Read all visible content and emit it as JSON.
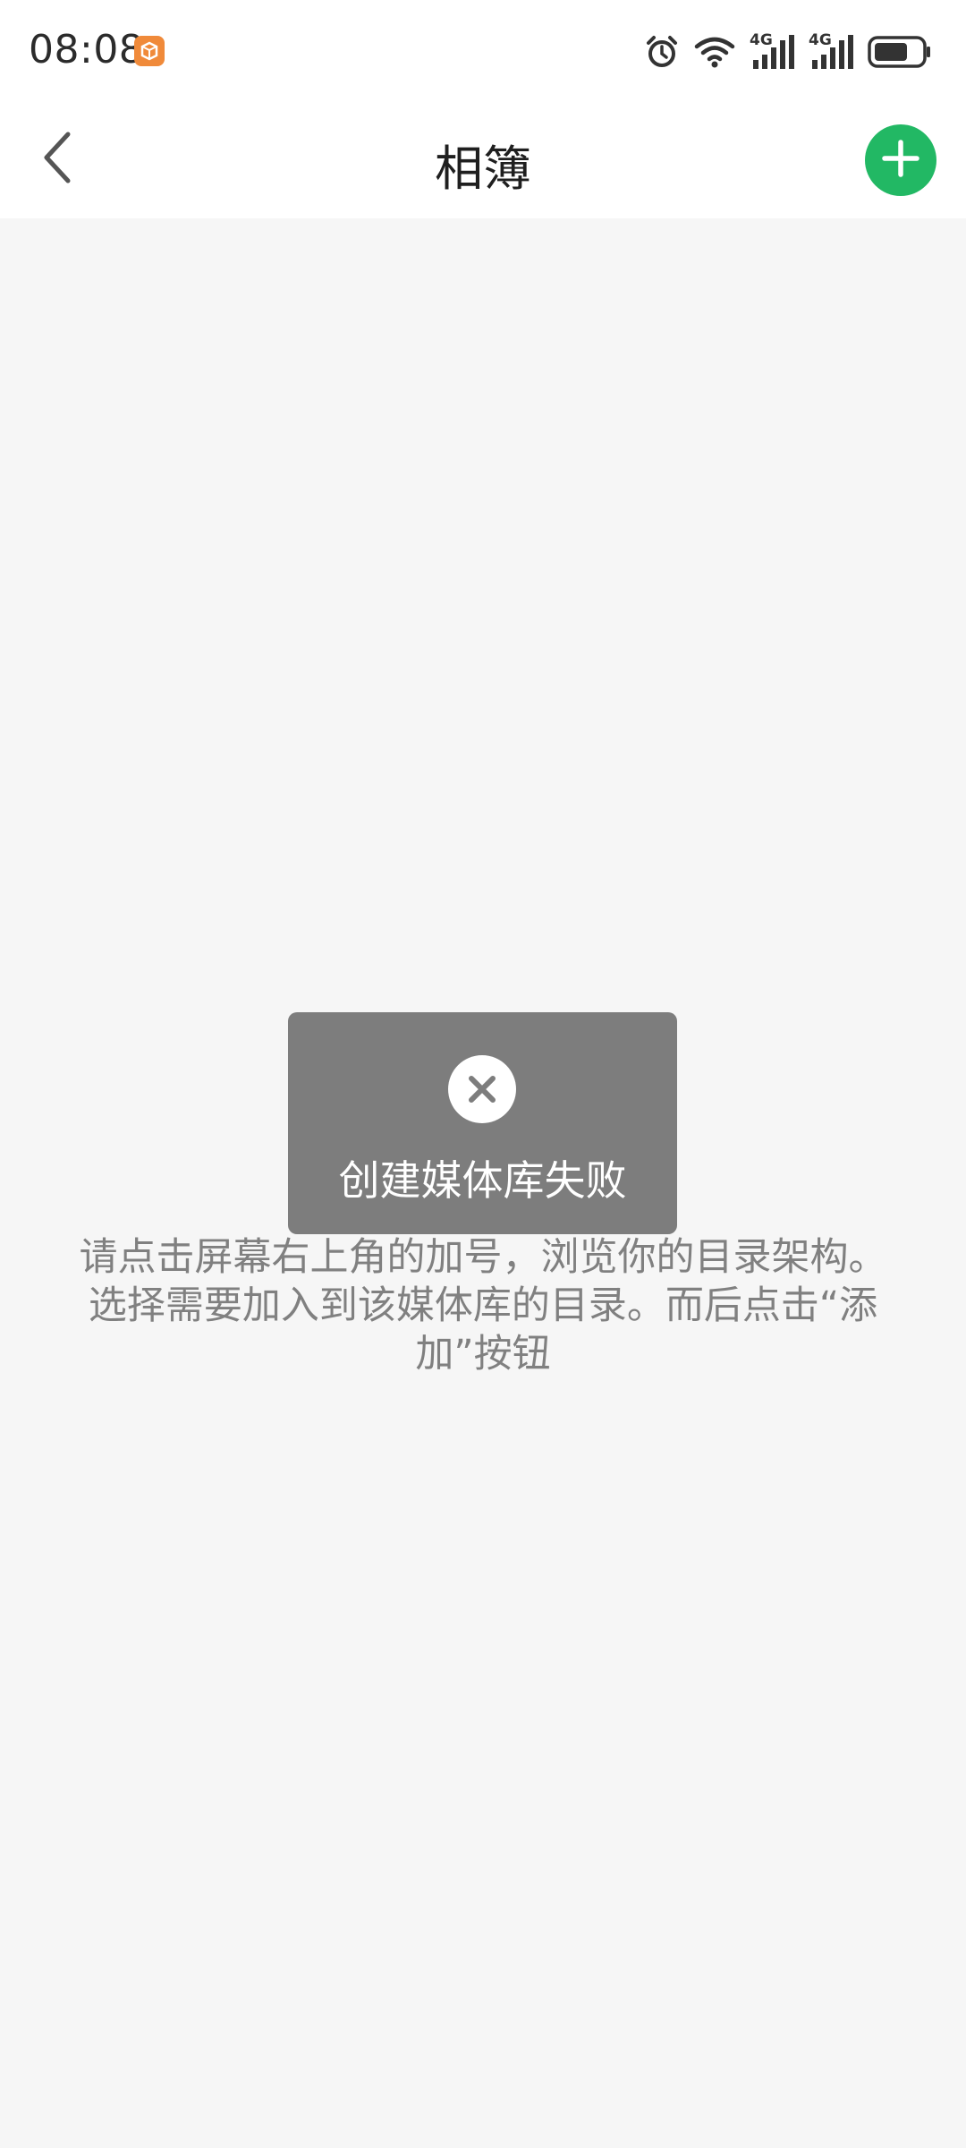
{
  "status_bar": {
    "time": "08:08",
    "signal_label_1": "4G",
    "signal_label_2": "4G",
    "icons": [
      "app-notification-icon",
      "alarm-icon",
      "wifi-icon",
      "signal-4g-icon",
      "signal-4g-icon",
      "battery-icon"
    ]
  },
  "header": {
    "title": "相簿",
    "back_icon": "chevron-left-icon",
    "add_icon": "plus-icon"
  },
  "toast": {
    "icon": "close-circle-icon",
    "message": "创建媒体库失败"
  },
  "main": {
    "instruction": "请点击屏幕右上角的加号，浏览你的目录架构。选择需要加入到该媒体库的目录。而后点击“添加”按钮"
  },
  "colors": {
    "accent": "#22b864",
    "toast_bg": "#7d7d7d",
    "page_bg": "#f6f6f6",
    "instruction_text": "#808080"
  }
}
